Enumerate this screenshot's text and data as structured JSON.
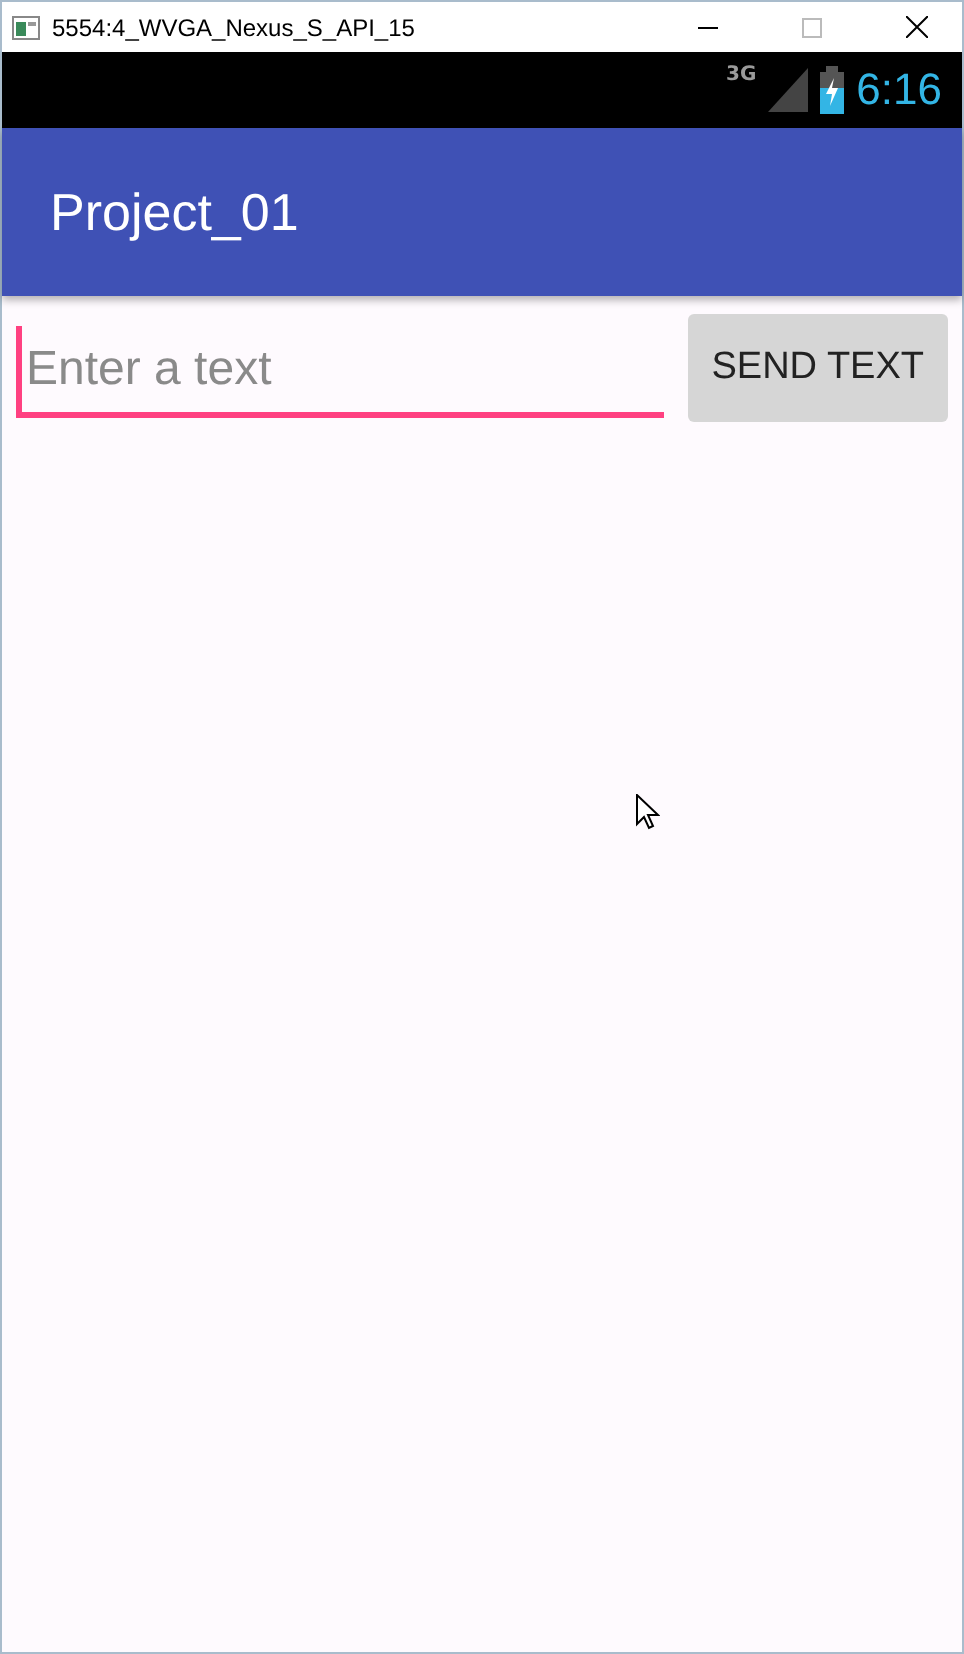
{
  "window": {
    "title": "5554:4_WVGA_Nexus_S_API_15"
  },
  "status_bar": {
    "network": "3G",
    "time": "6:16"
  },
  "app_bar": {
    "title": "Project_01"
  },
  "form": {
    "placeholder": "Enter a text",
    "focused": true,
    "button": "SEND TEXT"
  }
}
